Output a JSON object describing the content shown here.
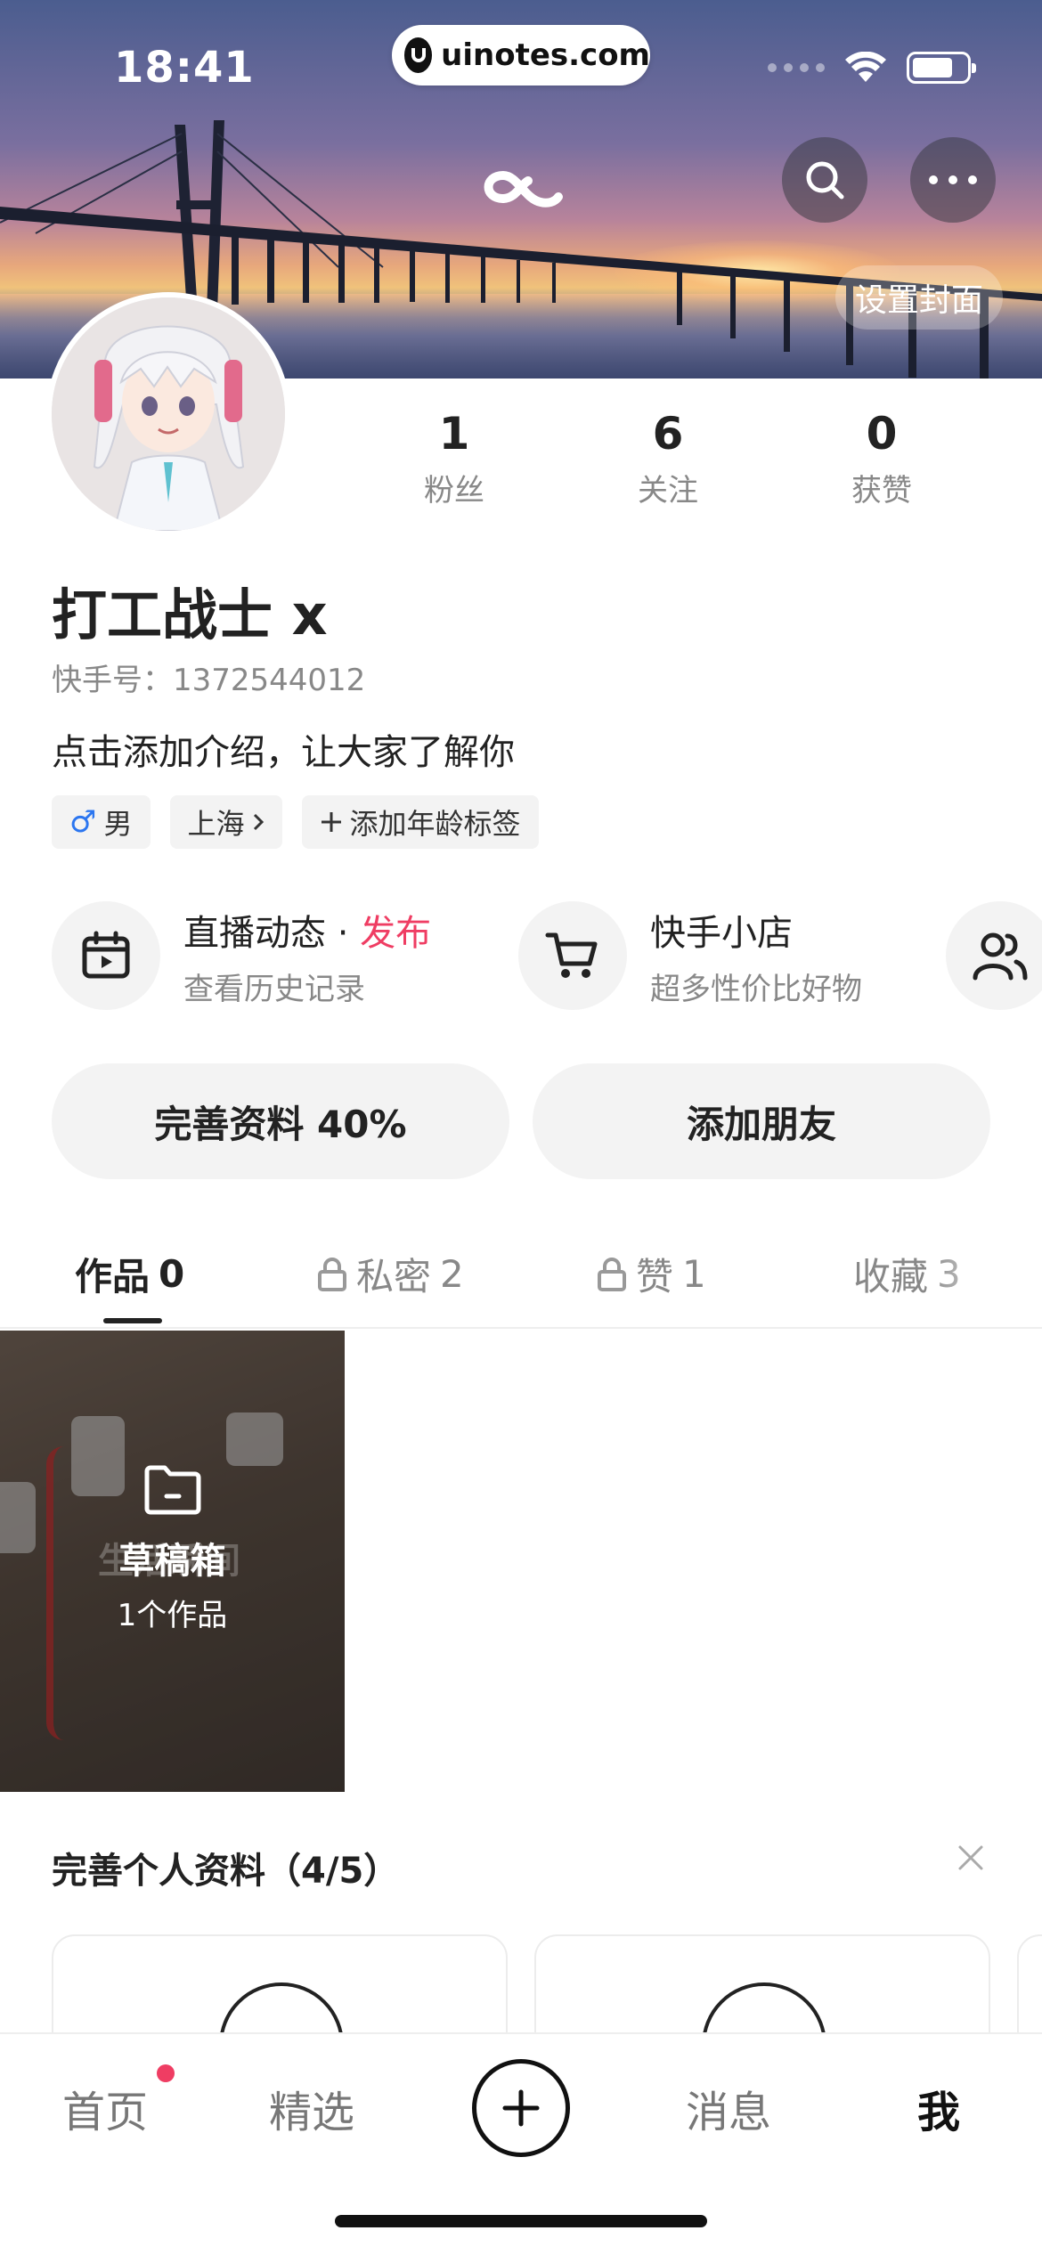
{
  "status_bar": {
    "time": "18:41",
    "url": "uinotes.com"
  },
  "header": {
    "set_cover_label": "设置封面",
    "search_icon": "search-icon",
    "more_icon": "more-icon"
  },
  "profile": {
    "stats": [
      {
        "value": "1",
        "label": "粉丝"
      },
      {
        "value": "6",
        "label": "关注"
      },
      {
        "value": "0",
        "label": "获赞"
      }
    ],
    "name": "打工战士 x",
    "uid": "快手号：1372544012",
    "bio": "点击添加介绍，让大家了解你",
    "tags": {
      "gender_symbol": "♂",
      "gender": "男",
      "location": "上海",
      "age_tag": "添加年龄标签"
    }
  },
  "features": [
    {
      "title": "直播动态",
      "separator": " · ",
      "accent": "发布",
      "subtitle": "查看历史记录",
      "icon": "calendar-play-icon"
    },
    {
      "title": "快手小店",
      "subtitle": "超多性价比好物",
      "icon": "cart-icon"
    },
    {
      "title": "",
      "subtitle": "",
      "icon": "friends-icon"
    }
  ],
  "actions": {
    "complete_profile": "完善资料 40%",
    "add_friends": "添加朋友"
  },
  "tabs": [
    {
      "label": "作品",
      "count": "0",
      "locked": false
    },
    {
      "label": "私密",
      "count": "2",
      "locked": true
    },
    {
      "label": "赞",
      "count": "1",
      "locked": true
    },
    {
      "label": "收藏",
      "count": "3",
      "locked": false
    }
  ],
  "draft": {
    "title": "草稿箱",
    "subtitle": "1个作品",
    "overlay_text": "生活瞬间"
  },
  "complete_section": {
    "title": "完善个人资料（4/5）"
  },
  "bottom_nav": {
    "home": "首页",
    "featured": "精选",
    "messages": "消息",
    "me": "我"
  },
  "colors": {
    "accent": "#ef3d63",
    "male_blue": "#2b76f0",
    "text": "#222222",
    "muted": "#888888",
    "pill_bg": "#f3f3f3"
  }
}
